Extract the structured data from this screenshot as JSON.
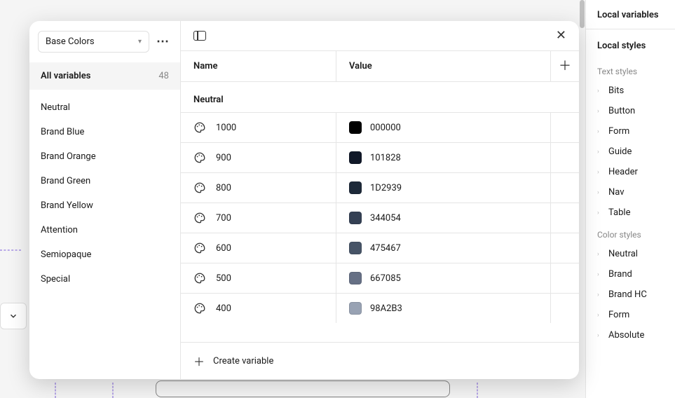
{
  "rightSidebar": {
    "heading1": "Local variables",
    "heading2": "Local styles",
    "textStylesLabel": "Text styles",
    "textStyles": [
      "Bits",
      "Button",
      "Form",
      "Guide",
      "Header",
      "Nav",
      "Table"
    ],
    "colorStylesLabel": "Color styles",
    "colorStyles": [
      "Neutral",
      "Brand",
      "Brand HC",
      "Form",
      "Absolute"
    ]
  },
  "modal": {
    "collectionName": "Base Colors",
    "allVariablesLabel": "All variables",
    "variableCount": "48",
    "groups": [
      "Neutral",
      "Brand Blue",
      "Brand Orange",
      "Brand Green",
      "Brand Yellow",
      "Attention",
      "Semiopaque",
      "Special"
    ],
    "columns": {
      "name": "Name",
      "value": "Value"
    },
    "sectionLabel": "Neutral",
    "rows": [
      {
        "name": "1000",
        "hex": "000000",
        "swatch": "#000000"
      },
      {
        "name": "900",
        "hex": "101828",
        "swatch": "#101828"
      },
      {
        "name": "800",
        "hex": "1D2939",
        "swatch": "#1D2939"
      },
      {
        "name": "700",
        "hex": "344054",
        "swatch": "#344054"
      },
      {
        "name": "600",
        "hex": "475467",
        "swatch": "#475467"
      },
      {
        "name": "500",
        "hex": "667085",
        "swatch": "#667085"
      },
      {
        "name": "400",
        "hex": "98A2B3",
        "swatch": "#98A2B3"
      }
    ],
    "createLabel": "Create variable"
  }
}
